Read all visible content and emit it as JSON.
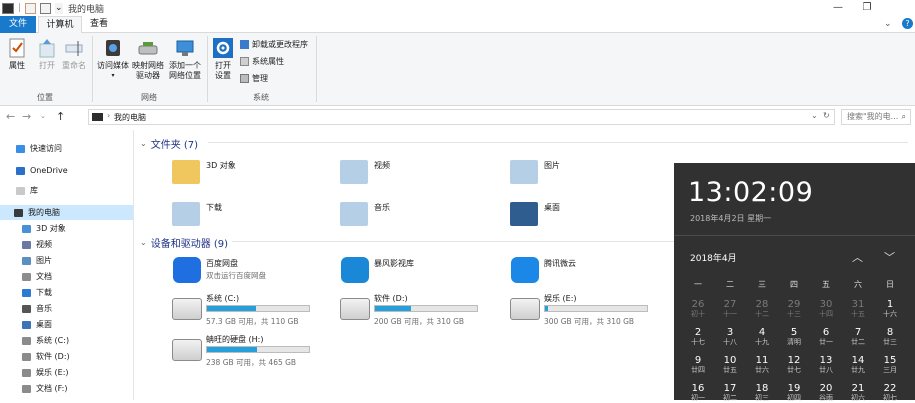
{
  "window": {
    "title": "我的电脑",
    "controls": {
      "minimize": "—",
      "maximize": "❐",
      "expand": "⌄",
      "help": "?"
    }
  },
  "tabs": [
    {
      "label": "文件"
    },
    {
      "label": "计算机"
    },
    {
      "label": "查看"
    }
  ],
  "ribbon": {
    "location_group": {
      "label": "位置",
      "buttons": [
        {
          "label": "属性",
          "icon": "properties-icon"
        },
        {
          "label": "打开",
          "icon": "open-icon"
        },
        {
          "label": "重命名",
          "icon": "rename-icon"
        }
      ]
    },
    "network_group": {
      "label": "网络",
      "buttons": [
        {
          "label": "访问媒体",
          "icon": "media-icon"
        },
        {
          "label": "映射网络驱动器",
          "line1": "映射网络",
          "line2": "驱动器",
          "icon": "map-drive-icon"
        },
        {
          "label": "添加一个网络位置",
          "line1": "添加一个",
          "line2": "网络位置",
          "icon": "network-location-icon"
        }
      ]
    },
    "system_group": {
      "label": "系统",
      "open_settings": {
        "line1": "打开",
        "line2": "设置",
        "icon": "gear-icon"
      },
      "small_buttons": [
        {
          "label": "卸载或更改程序",
          "icon": "uninstall-icon"
        },
        {
          "label": "系统属性",
          "icon": "system-properties-icon"
        },
        {
          "label": "管理",
          "icon": "manage-icon"
        }
      ]
    }
  },
  "address_bar": {
    "path": "我的电脑",
    "search_placeholder": "搜索\"我的电..."
  },
  "sidebar": {
    "items": [
      {
        "label": "快速访问",
        "icon": "star-icon",
        "color": "#3a8ee6"
      },
      {
        "label": "OneDrive",
        "icon": "cloud-icon",
        "color": "#2a6fc9"
      },
      {
        "label": "库",
        "icon": "library-icon",
        "color": "#c9c9c9"
      },
      {
        "label": "我的电脑",
        "icon": "computer-icon",
        "color": "#3a3a3a",
        "selected": true
      },
      {
        "label": "3D 对象",
        "icon": "cube-icon",
        "color": "#4a90d9"
      },
      {
        "label": "视频",
        "icon": "video-icon",
        "color": "#6a7aa0"
      },
      {
        "label": "图片",
        "icon": "picture-icon",
        "color": "#5c8fbf"
      },
      {
        "label": "文档",
        "icon": "document-icon",
        "color": "#8c8c8c"
      },
      {
        "label": "下载",
        "icon": "download-icon",
        "color": "#2b7bd4"
      },
      {
        "label": "音乐",
        "icon": "music-icon",
        "color": "#555555"
      },
      {
        "label": "桌面",
        "icon": "desktop-icon",
        "color": "#3c75b5"
      },
      {
        "label": "系统 (C:)",
        "icon": "drive-icon",
        "color": "#8b8b8b"
      },
      {
        "label": "软件 (D:)",
        "icon": "drive-icon",
        "color": "#8b8b8b"
      },
      {
        "label": "娱乐 (E:)",
        "icon": "drive-icon",
        "color": "#8b8b8b"
      },
      {
        "label": "文档 (F:)",
        "icon": "drive-icon",
        "color": "#8b8b8b"
      }
    ]
  },
  "folders": {
    "header": "文件夹 (7)",
    "items": [
      {
        "label": "3D 对象",
        "icon": "cube-folder-icon",
        "color": "#f0c75e"
      },
      {
        "label": "视频",
        "icon": "video-folder-icon",
        "color": "#b5cfe7"
      },
      {
        "label": "图片",
        "icon": "picture-folder-icon",
        "color": "#b5cfe7"
      },
      {
        "label": "下载",
        "icon": "download-folder-icon",
        "color": "#b5cfe7"
      },
      {
        "label": "音乐",
        "icon": "music-folder-icon",
        "color": "#b5cfe7"
      },
      {
        "label": "桌面",
        "icon": "desktop-folder-icon",
        "color": "#2f5d8f"
      }
    ]
  },
  "devices": {
    "header": "设备和驱动器 (9)",
    "apps": [
      {
        "name": "百度网盘",
        "sub": "双击运行百度网盘",
        "icon": "baidu-netdisk-icon",
        "color": "#1f6fe0"
      },
      {
        "name": "暴风影视库",
        "sub": "",
        "icon": "baofeng-icon",
        "color": "#1a88d6"
      },
      {
        "name": "腾讯微云",
        "sub": "",
        "icon": "weiyun-icon",
        "color": "#1b87e6"
      }
    ],
    "drives": [
      {
        "name": "系统 (C:)",
        "free": "57.3 GB 可用，共 110 GB",
        "used_fraction": 0.48,
        "icon": "windows-drive-icon"
      },
      {
        "name": "软件 (D:)",
        "free": "200 GB 可用，共 310 GB",
        "used_fraction": 0.35,
        "icon": "drive-icon"
      },
      {
        "name": "娱乐 (E:)",
        "free": "300 GB 可用，共 310 GB",
        "used_fraction": 0.03,
        "icon": "drive-icon"
      },
      {
        "name": "蚺旺的硬盘 (H:)",
        "free": "238 GB 可用，共 465 GB",
        "used_fraction": 0.49,
        "icon": "drive-icon"
      }
    ]
  },
  "clock": {
    "time": "13:02:09",
    "date": "2018年4月2日 星期一",
    "month": "2018年4月",
    "prev": "︿",
    "next": "﹀",
    "weekdays": [
      "一",
      "二",
      "三",
      "四",
      "五",
      "六",
      "日"
    ],
    "rows": [
      [
        {
          "d": "26",
          "l": "初十",
          "dim": true
        },
        {
          "d": "27",
          "l": "十一",
          "dim": true
        },
        {
          "d": "28",
          "l": "十二",
          "dim": true
        },
        {
          "d": "29",
          "l": "十三",
          "dim": true
        },
        {
          "d": "30",
          "l": "十四",
          "dim": true
        },
        {
          "d": "31",
          "l": "十五",
          "dim": true
        },
        {
          "d": "1",
          "l": "十六"
        }
      ],
      [
        {
          "d": "2",
          "l": "十七"
        },
        {
          "d": "3",
          "l": "十八"
        },
        {
          "d": "4",
          "l": "十九"
        },
        {
          "d": "5",
          "l": "清明"
        },
        {
          "d": "6",
          "l": "廿一"
        },
        {
          "d": "7",
          "l": "廿二"
        },
        {
          "d": "8",
          "l": "廿三"
        }
      ],
      [
        {
          "d": "9",
          "l": "廿四"
        },
        {
          "d": "10",
          "l": "廿五"
        },
        {
          "d": "11",
          "l": "廿六"
        },
        {
          "d": "12",
          "l": "廿七"
        },
        {
          "d": "13",
          "l": "廿八"
        },
        {
          "d": "14",
          "l": "廿九"
        },
        {
          "d": "15",
          "l": "三月"
        }
      ],
      [
        {
          "d": "16",
          "l": "初一"
        },
        {
          "d": "17",
          "l": "初二"
        },
        {
          "d": "18",
          "l": "初三"
        },
        {
          "d": "19",
          "l": "初四"
        },
        {
          "d": "20",
          "l": "谷雨"
        },
        {
          "d": "21",
          "l": "初六"
        },
        {
          "d": "22",
          "l": "初七"
        }
      ]
    ]
  }
}
